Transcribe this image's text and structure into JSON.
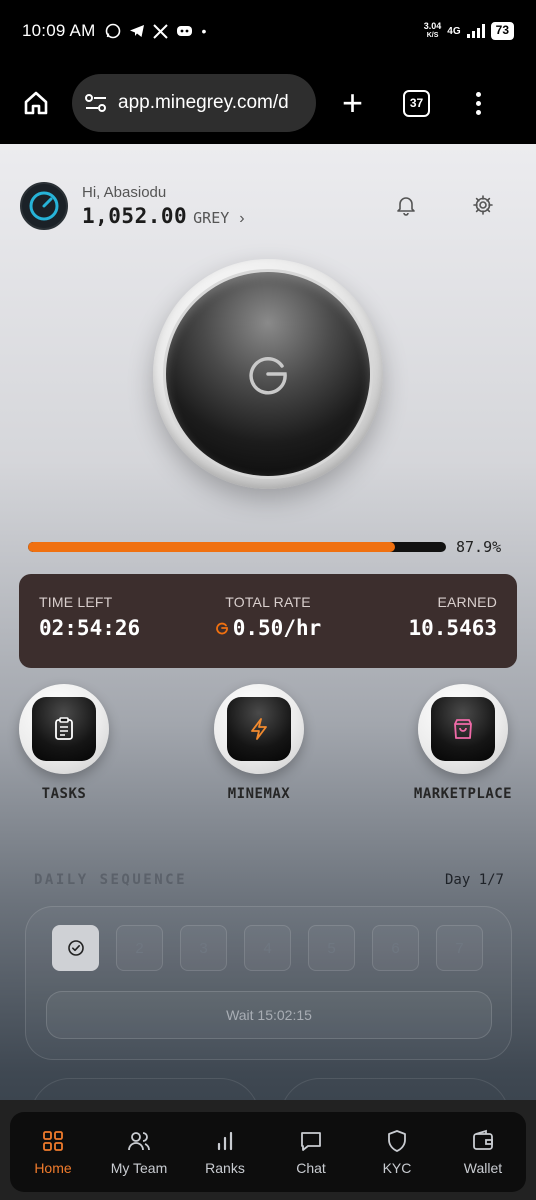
{
  "status_bar": {
    "time": "10:09 AM",
    "speed_value": "3.04",
    "speed_unit": "K/S",
    "network": "4G",
    "battery": "73"
  },
  "browser": {
    "url": "app.minegrey.com/d",
    "tab_count": "37"
  },
  "header": {
    "greeting": "Hi, Abasiodu",
    "balance": "1,052.00",
    "currency": "GREY",
    "chevron": "›"
  },
  "progress": {
    "value": 0.879,
    "label": "87.9%"
  },
  "stats": {
    "time_left_label": "TIME LEFT",
    "time_left": "02:54:26",
    "total_rate_label": "TOTAL RATE",
    "total_rate": "0.50/hr",
    "earned_label": "EARNED",
    "earned": "10.5463"
  },
  "actions": [
    {
      "label": "TASKS",
      "icon": "clipboard-icon",
      "color": "#ffffff"
    },
    {
      "label": "MINEMAX",
      "icon": "lightning-icon",
      "color": "#f28a2e"
    },
    {
      "label": "MARKETPLACE",
      "icon": "shopping-bag-icon",
      "color": "#f06aa8"
    }
  ],
  "daily": {
    "title": "DAILY SEQUENCE",
    "day_progress": "Day 1/7",
    "days": [
      "",
      "2",
      "3",
      "4",
      "5",
      "6",
      "7"
    ],
    "wait_label": "Wait 15:02:15"
  },
  "nav": {
    "items": [
      {
        "label": "Home",
        "icon": "grid-icon",
        "active": true
      },
      {
        "label": "My Team",
        "icon": "users-icon",
        "active": false
      },
      {
        "label": "Ranks",
        "icon": "bar-chart-icon",
        "active": false
      },
      {
        "label": "Chat",
        "icon": "chat-icon",
        "active": false
      },
      {
        "label": "KYC",
        "icon": "shield-icon",
        "active": false
      },
      {
        "label": "Wallet",
        "icon": "wallet-icon",
        "active": false
      }
    ]
  },
  "colors": {
    "accent": "#f07010",
    "stats_bg": "#3c2e2d",
    "nav_active": "#f07b2c"
  }
}
